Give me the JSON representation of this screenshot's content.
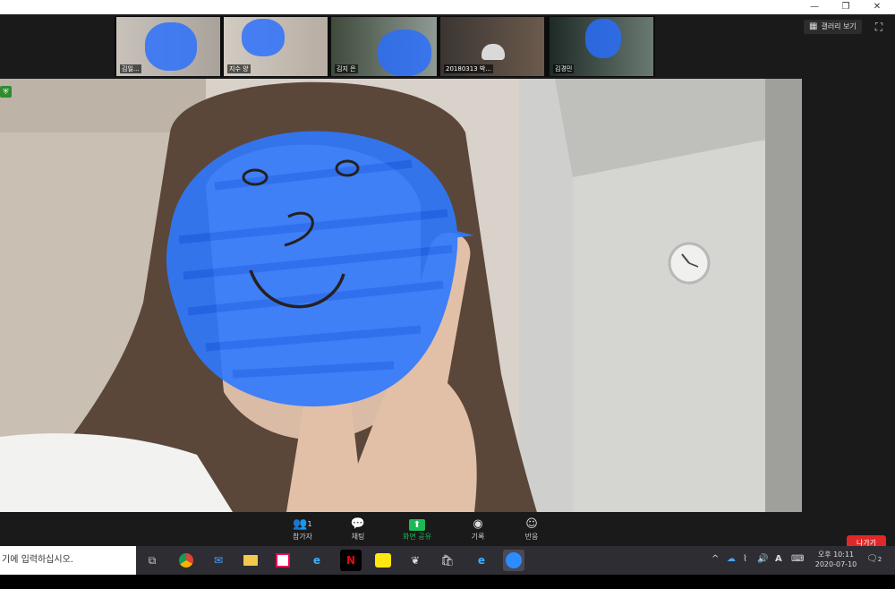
{
  "window": {
    "minimize_icon": "minus-icon",
    "restore_icon": "restore-icon",
    "close_icon": "close-icon"
  },
  "participants": [
    {
      "name": "김일..."
    },
    {
      "name": "지수 양"
    },
    {
      "name": "김지 은"
    },
    {
      "name": "20180313 박..."
    },
    {
      "name": "김경민"
    }
  ],
  "view": {
    "gallery_label": "갤러리 보기"
  },
  "active_speaker": {
    "name_tag": "은"
  },
  "toolbar": {
    "participants_label": "참가자",
    "participants_count": "1",
    "chat_label": "채팅",
    "share_label": "화면 공유",
    "record_label": "기록",
    "reactions_label": "반응",
    "leave_label": "나가기"
  },
  "taskbar": {
    "search_placeholder": "기에 입력하십시오.",
    "input_indicator": "A",
    "time": "오후 10:11",
    "date": "2020-07-10",
    "notification_count": "2"
  },
  "colors": {
    "accent": "#1db954",
    "leave": "#e02828",
    "blob": "#286eff"
  }
}
